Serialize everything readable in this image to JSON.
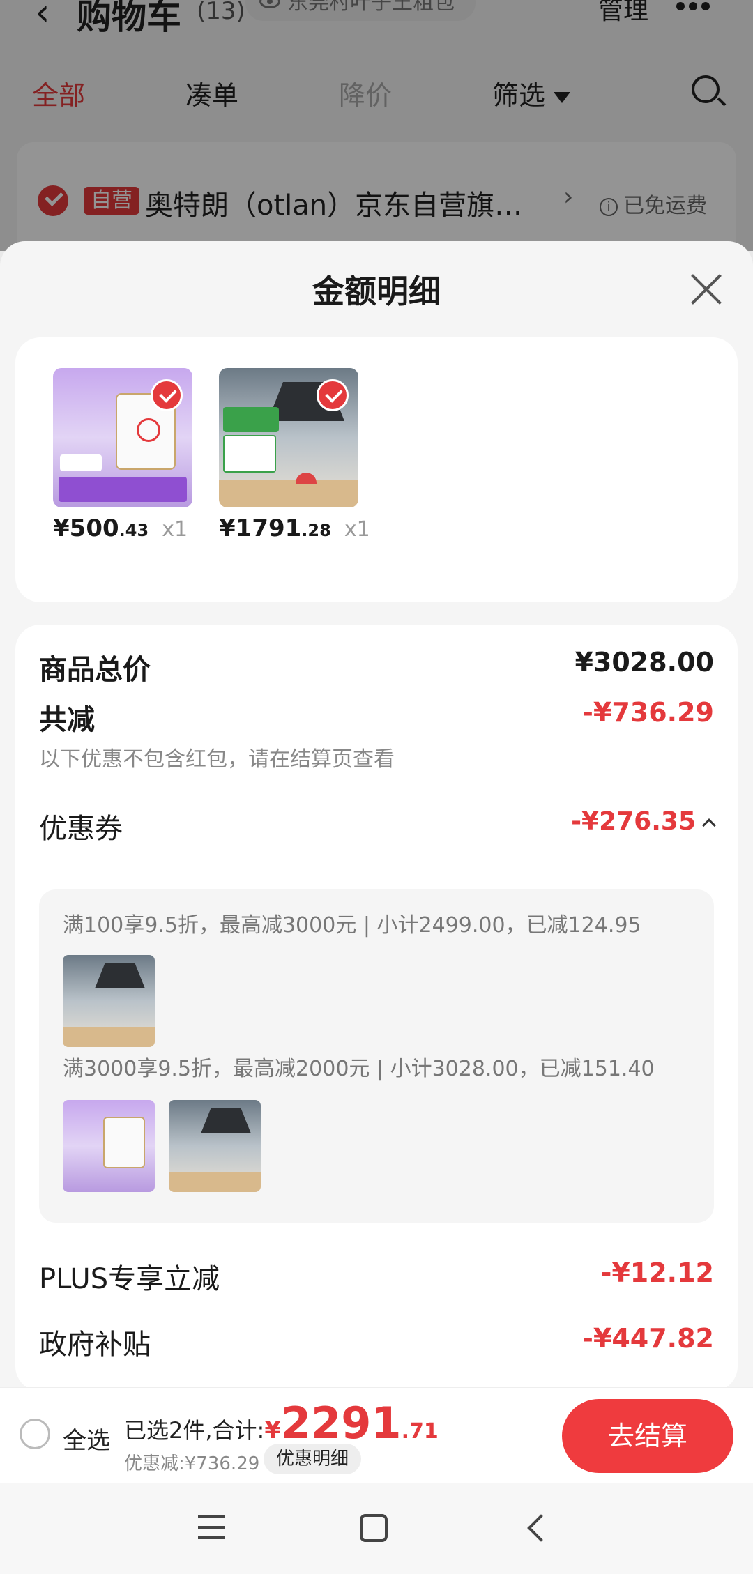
{
  "background_page": {
    "title": "购物车",
    "count": "(13)",
    "address": "东莞村叶子王粗包",
    "manage": "管理",
    "tabs": [
      "全部",
      "凑单",
      "降价",
      "筛选"
    ],
    "store": {
      "badge": "自营",
      "name": "奥特朗（otlan）京东自营旗…",
      "shipping": "已免运费"
    }
  },
  "sheet": {
    "title": "金额明细",
    "products": [
      {
        "price_main": "¥500",
        "price_cents": ".43",
        "qty": "x1"
      },
      {
        "price_main": "¥1791",
        "price_cents": ".28",
        "qty": "x1"
      }
    ],
    "details": {
      "total_label": "商品总价",
      "total_value": "¥3028.00",
      "reduce_label": "共减",
      "reduce_value": "-¥736.29",
      "reduce_note": "以下优惠不包含红包，请在结算页查看",
      "coupon_label": "优惠券",
      "coupon_value": "-¥276.35",
      "coupon_rules": [
        "满100享9.5折，最高减3000元 | 小计2499.00，已减124.95",
        "满3000享9.5折，最高减2000元 | 小计3028.00，已减151.40"
      ],
      "plus_label": "PLUS专享立减",
      "plus_value": "-¥12.12",
      "gov_label": "政府补贴",
      "gov_value": "-¥447.82"
    }
  },
  "bottom_bar": {
    "select_all": "全选",
    "selected_text": "已选2件,合计:",
    "currency": "¥",
    "total_main": "2291",
    "total_cents": ".71",
    "discount_text": "优惠减:¥736.29",
    "detail_pill": "优惠明细",
    "checkout": "去结算"
  },
  "colors": {
    "accent_red": "#e4393c",
    "button_red": "#ef3b3e"
  }
}
